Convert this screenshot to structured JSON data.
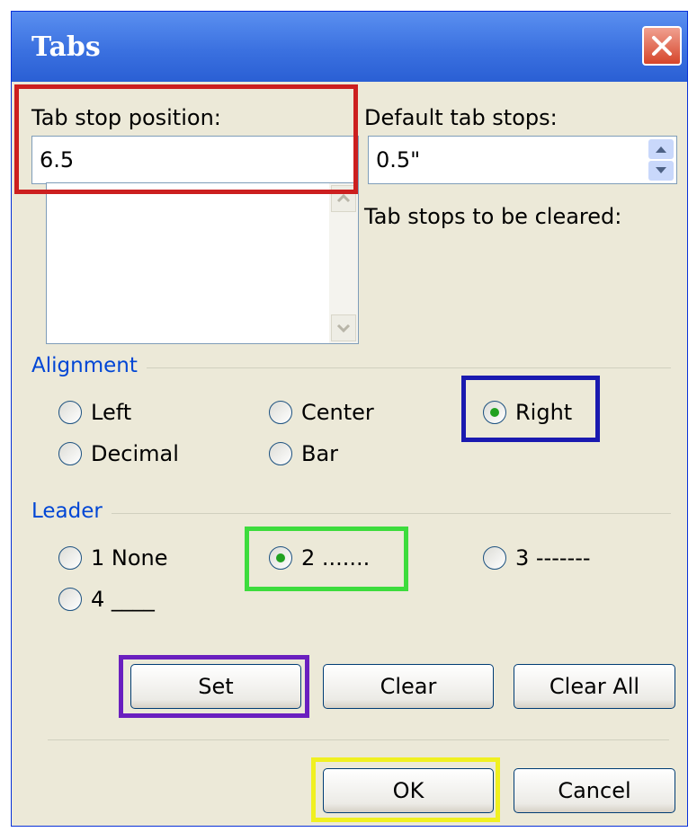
{
  "dialog": {
    "title": "Tabs",
    "tab_stop_position": {
      "label": "Tab stop position:",
      "value": "6.5"
    },
    "default_tab_stops": {
      "label": "Default tab stops:",
      "value": "0.5\""
    },
    "tab_stops_to_clear_label": "Tab stops to be cleared:"
  },
  "alignment": {
    "label": "Alignment",
    "options": [
      "Left",
      "Center",
      "Right",
      "Decimal",
      "Bar"
    ],
    "selected": "Right"
  },
  "leader": {
    "label": "Leader",
    "options": [
      "1 None",
      "2 .......",
      "3 -------",
      "4 ____"
    ],
    "selected": "2 ......."
  },
  "buttons": {
    "set": "Set",
    "clear": "Clear",
    "clear_all": "Clear All",
    "ok": "OK",
    "cancel": "Cancel"
  },
  "highlight_colors": {
    "red": "#cc1f1f",
    "blue": "#1a1ab0",
    "green": "#3ddc3d",
    "purple": "#6a1fbf",
    "yellow": "#f0f020"
  }
}
